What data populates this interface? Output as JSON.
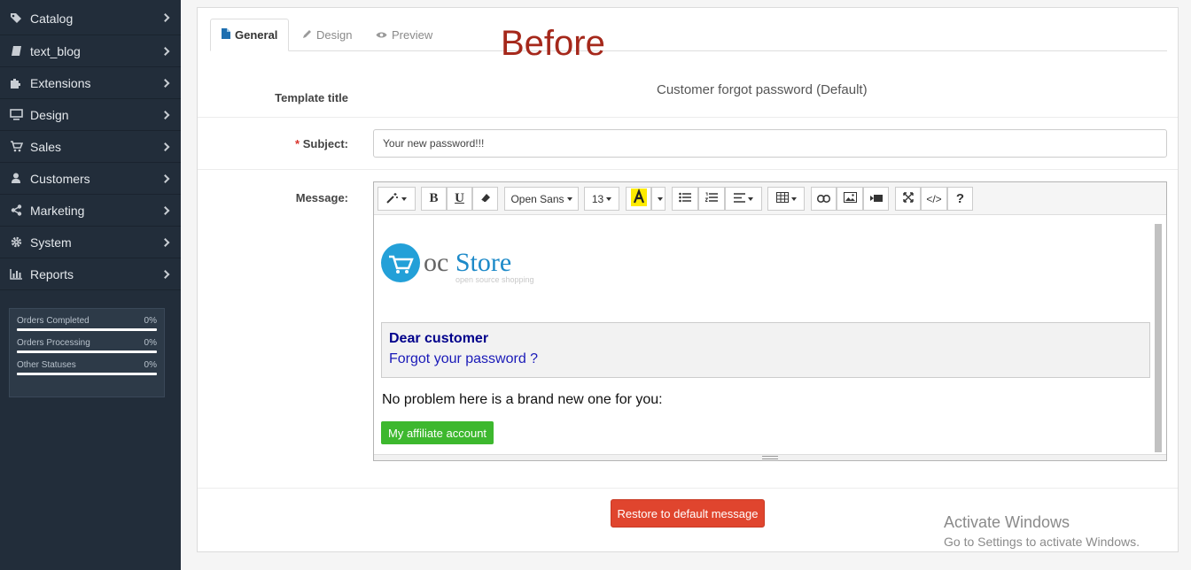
{
  "sidebar": {
    "items": [
      {
        "label": "Catalog",
        "icon": "tags-icon"
      },
      {
        "label": "text_blog",
        "icon": "book-icon"
      },
      {
        "label": "Extensions",
        "icon": "puzzle-icon"
      },
      {
        "label": "Design",
        "icon": "monitor-icon"
      },
      {
        "label": "Sales",
        "icon": "cart-icon"
      },
      {
        "label": "Customers",
        "icon": "user-icon"
      },
      {
        "label": "Marketing",
        "icon": "share-icon"
      },
      {
        "label": "System",
        "icon": "gear-icon"
      },
      {
        "label": "Reports",
        "icon": "bar-chart-icon"
      }
    ],
    "stats": [
      {
        "label": "Orders Completed",
        "value": "0%",
        "progress": 0
      },
      {
        "label": "Orders Processing",
        "value": "0%",
        "progress": 0
      },
      {
        "label": "Other Statuses",
        "value": "0%",
        "progress": 0
      }
    ]
  },
  "tabs": {
    "general": "General",
    "design": "Design",
    "preview": "Preview"
  },
  "annotation": "Before",
  "form": {
    "template_title_label": "Template title",
    "template_title_value": "Customer forgot password (Default)",
    "subject_label": "Subject:",
    "subject_required_mark": "*",
    "subject_value": "Your new password!!!",
    "message_label": "Message:"
  },
  "toolbar": {
    "font_name": "Open Sans",
    "font_size": "13",
    "bold": "B",
    "underline": "U",
    "help": "?",
    "code": "</>"
  },
  "email": {
    "logo_oc": "oc",
    "logo_store": "Store",
    "logo_tagline": "open source shopping",
    "greeting_title": "Dear customer",
    "greeting_text": "Forgot your password ?",
    "body_text": "No problem here is a brand new one for you:",
    "affiliate_button": "My affiliate account"
  },
  "restore_button": "Restore to default message",
  "windows_watermark": {
    "title": "Activate Windows",
    "subtitle": "Go to Settings to activate Windows."
  },
  "colors": {
    "sidebar_bg": "#222d3a",
    "restore_button": "#e0452e",
    "affiliate_button": "#3db82e",
    "annotation": "#a5281b"
  }
}
